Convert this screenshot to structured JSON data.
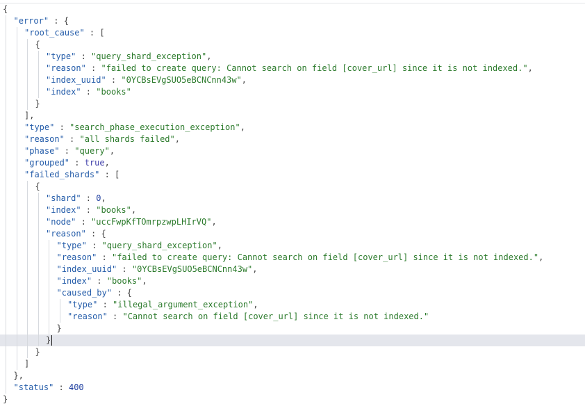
{
  "lines": [
    {
      "indent": 0,
      "tokens": [
        {
          "t": "p",
          "v": "{"
        }
      ]
    },
    {
      "indent": 1,
      "tokens": [
        {
          "t": "k",
          "v": "\"error\""
        },
        {
          "t": "p",
          "v": " : {"
        }
      ]
    },
    {
      "indent": 2,
      "tokens": [
        {
          "t": "k",
          "v": "\"root_cause\""
        },
        {
          "t": "p",
          "v": " : ["
        }
      ]
    },
    {
      "indent": 3,
      "tokens": [
        {
          "t": "p",
          "v": "{"
        }
      ]
    },
    {
      "indent": 4,
      "tokens": [
        {
          "t": "k",
          "v": "\"type\""
        },
        {
          "t": "p",
          "v": " : "
        },
        {
          "t": "s",
          "v": "\"query_shard_exception\""
        },
        {
          "t": "p",
          "v": ","
        }
      ]
    },
    {
      "indent": 4,
      "tokens": [
        {
          "t": "k",
          "v": "\"reason\""
        },
        {
          "t": "p",
          "v": " : "
        },
        {
          "t": "s",
          "v": "\"failed to create query: Cannot search on field [cover_url] since it is not indexed.\""
        },
        {
          "t": "p",
          "v": ","
        }
      ]
    },
    {
      "indent": 4,
      "tokens": [
        {
          "t": "k",
          "v": "\"index_uuid\""
        },
        {
          "t": "p",
          "v": " : "
        },
        {
          "t": "s",
          "v": "\"0YCBsEVgSUO5eBCNCnn43w\""
        },
        {
          "t": "p",
          "v": ","
        }
      ]
    },
    {
      "indent": 4,
      "tokens": [
        {
          "t": "k",
          "v": "\"index\""
        },
        {
          "t": "p",
          "v": " : "
        },
        {
          "t": "s",
          "v": "\"books\""
        }
      ]
    },
    {
      "indent": 3,
      "tokens": [
        {
          "t": "p",
          "v": "}"
        }
      ]
    },
    {
      "indent": 2,
      "tokens": [
        {
          "t": "p",
          "v": "],"
        }
      ]
    },
    {
      "indent": 2,
      "tokens": [
        {
          "t": "k",
          "v": "\"type\""
        },
        {
          "t": "p",
          "v": " : "
        },
        {
          "t": "s",
          "v": "\"search_phase_execution_exception\""
        },
        {
          "t": "p",
          "v": ","
        }
      ]
    },
    {
      "indent": 2,
      "tokens": [
        {
          "t": "k",
          "v": "\"reason\""
        },
        {
          "t": "p",
          "v": " : "
        },
        {
          "t": "s",
          "v": "\"all shards failed\""
        },
        {
          "t": "p",
          "v": ","
        }
      ]
    },
    {
      "indent": 2,
      "tokens": [
        {
          "t": "k",
          "v": "\"phase\""
        },
        {
          "t": "p",
          "v": " : "
        },
        {
          "t": "s",
          "v": "\"query\""
        },
        {
          "t": "p",
          "v": ","
        }
      ]
    },
    {
      "indent": 2,
      "tokens": [
        {
          "t": "k",
          "v": "\"grouped\""
        },
        {
          "t": "p",
          "v": " : "
        },
        {
          "t": "b",
          "v": "true"
        },
        {
          "t": "p",
          "v": ","
        }
      ]
    },
    {
      "indent": 2,
      "tokens": [
        {
          "t": "k",
          "v": "\"failed_shards\""
        },
        {
          "t": "p",
          "v": " : ["
        }
      ]
    },
    {
      "indent": 3,
      "tokens": [
        {
          "t": "p",
          "v": "{"
        }
      ]
    },
    {
      "indent": 4,
      "tokens": [
        {
          "t": "k",
          "v": "\"shard\""
        },
        {
          "t": "p",
          "v": " : "
        },
        {
          "t": "n",
          "v": "0"
        },
        {
          "t": "p",
          "v": ","
        }
      ]
    },
    {
      "indent": 4,
      "tokens": [
        {
          "t": "k",
          "v": "\"index\""
        },
        {
          "t": "p",
          "v": " : "
        },
        {
          "t": "s",
          "v": "\"books\""
        },
        {
          "t": "p",
          "v": ","
        }
      ]
    },
    {
      "indent": 4,
      "tokens": [
        {
          "t": "k",
          "v": "\"node\""
        },
        {
          "t": "p",
          "v": " : "
        },
        {
          "t": "s",
          "v": "\"uccFwpKfTOmrpzwpLHIrVQ\""
        },
        {
          "t": "p",
          "v": ","
        }
      ]
    },
    {
      "indent": 4,
      "tokens": [
        {
          "t": "k",
          "v": "\"reason\""
        },
        {
          "t": "p",
          "v": " : {"
        }
      ]
    },
    {
      "indent": 5,
      "tokens": [
        {
          "t": "k",
          "v": "\"type\""
        },
        {
          "t": "p",
          "v": " : "
        },
        {
          "t": "s",
          "v": "\"query_shard_exception\""
        },
        {
          "t": "p",
          "v": ","
        }
      ]
    },
    {
      "indent": 5,
      "tokens": [
        {
          "t": "k",
          "v": "\"reason\""
        },
        {
          "t": "p",
          "v": " : "
        },
        {
          "t": "s",
          "v": "\"failed to create query: Cannot search on field [cover_url] since it is not indexed.\""
        },
        {
          "t": "p",
          "v": ","
        }
      ]
    },
    {
      "indent": 5,
      "tokens": [
        {
          "t": "k",
          "v": "\"index_uuid\""
        },
        {
          "t": "p",
          "v": " : "
        },
        {
          "t": "s",
          "v": "\"0YCBsEVgSUO5eBCNCnn43w\""
        },
        {
          "t": "p",
          "v": ","
        }
      ]
    },
    {
      "indent": 5,
      "tokens": [
        {
          "t": "k",
          "v": "\"index\""
        },
        {
          "t": "p",
          "v": " : "
        },
        {
          "t": "s",
          "v": "\"books\""
        },
        {
          "t": "p",
          "v": ","
        }
      ]
    },
    {
      "indent": 5,
      "tokens": [
        {
          "t": "k",
          "v": "\"caused_by\""
        },
        {
          "t": "p",
          "v": " : {"
        }
      ]
    },
    {
      "indent": 6,
      "tokens": [
        {
          "t": "k",
          "v": "\"type\""
        },
        {
          "t": "p",
          "v": " : "
        },
        {
          "t": "s",
          "v": "\"illegal_argument_exception\""
        },
        {
          "t": "p",
          "v": ","
        }
      ]
    },
    {
      "indent": 6,
      "tokens": [
        {
          "t": "k",
          "v": "\"reason\""
        },
        {
          "t": "p",
          "v": " : "
        },
        {
          "t": "s",
          "v": "\"Cannot search on field [cover_url] since it is not indexed.\""
        }
      ]
    },
    {
      "indent": 5,
      "tokens": [
        {
          "t": "p",
          "v": "}"
        }
      ]
    },
    {
      "indent": 4,
      "tokens": [
        {
          "t": "p",
          "v": "}"
        }
      ],
      "active": true
    },
    {
      "indent": 3,
      "tokens": [
        {
          "t": "p",
          "v": "}"
        }
      ]
    },
    {
      "indent": 2,
      "tokens": [
        {
          "t": "p",
          "v": "]"
        }
      ]
    },
    {
      "indent": 1,
      "tokens": [
        {
          "t": "p",
          "v": "},"
        }
      ]
    },
    {
      "indent": 1,
      "tokens": [
        {
          "t": "k",
          "v": "\"status\""
        },
        {
          "t": "p",
          "v": " : "
        },
        {
          "t": "n",
          "v": "400"
        }
      ]
    },
    {
      "indent": 0,
      "tokens": [
        {
          "t": "p",
          "v": "}"
        }
      ]
    }
  ],
  "colors": {
    "key": "#245ca9",
    "string": "#2b7a2b",
    "number": "#1f3fa0",
    "boolean": "#3b3ba8",
    "punctuation": "#444444",
    "active_line": "#e4e6ec",
    "indent_guide": "#d6d9de"
  }
}
